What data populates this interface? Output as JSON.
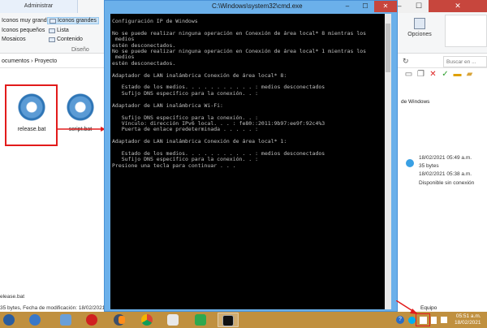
{
  "explorer": {
    "ribbon_tab": "Administrar",
    "layout_options": [
      "Iconos muy grandes",
      "Iconos grandes",
      "Iconos pequeños",
      "Lista",
      "Mosaicos",
      "Contenido"
    ],
    "group_label": "Diseño",
    "options_label": "Opciones",
    "breadcrumb": "ocumentos  ›  Proyecto",
    "search_placeholder": "Buscar en ...",
    "files": [
      {
        "name": "release.bat",
        "icon": "batch-file-icon"
      },
      {
        "name": "script.bat",
        "icon": "batch-file-icon"
      }
    ],
    "details": {
      "partial_text": "de Windows",
      "modified": "18/02/2021 05:49 a.m.",
      "size": "35 bytes",
      "created": "18/02/2021 05:38 a.m.",
      "availability": "Disponible sin conexión"
    },
    "status_count": "elease.bat",
    "status_text": "35 bytes, Fecha de modificación: 18/02/2021 0"
  },
  "cmd": {
    "title": "C:\\Windows\\system32\\cmd.exe",
    "console_text": "Configuración IP de Windows\n\nNo se puede realizar ninguna operación en Conexión de área local* 8 mientras los\n medios\nestén desconectados.\nNo se puede realizar ninguna operación en Conexión de área local* 1 mientras los\n medios\nestén desconectados.\n\nAdaptador de LAN inalámbrica Conexión de área local* 8:\n\n   Estado de los medios. . . . . . . . . . . : medios desconectados\n   Sufijo DNS específico para la conexión. . :\n\nAdaptador de LAN inalámbrica Wi-Fi:\n\n   Sufijo DNS específico para la conexión. . :\n   Vínculo: dirección IPv6 local. . . : fe80::2011:9b97:ee9f:92c4%3\n   Puerta de enlace predeterminada . . . . . :\n\nAdaptador de LAN inalámbrica Conexión de área local* 1:\n\n   Estado de los medios. . . . . . . . . . . : medios desconectados\n   Sufijo DNS específico para la conexión. . :\nPresione una tecla para continuar . . ."
  },
  "taskbar": {
    "apps": [
      "windows-start-icon",
      "internet-explorer-icon",
      "paint-icon",
      "red-asterisk-app-icon",
      "keepass-lock-icon",
      "vlc-icon",
      "chrome-icon",
      "tablet-app-icon",
      "photoshop-icon",
      "notepad-plus-icon",
      "cmd-icon",
      "file-explorer-icon"
    ],
    "tray_tooltip": "Equipo",
    "time": "05:51 a.m.",
    "date": "18/02/2021"
  },
  "colors": {
    "taskbar": "#c0903f",
    "cmd_frame": "#6bb0ea",
    "highlight": "#e21b1b"
  }
}
